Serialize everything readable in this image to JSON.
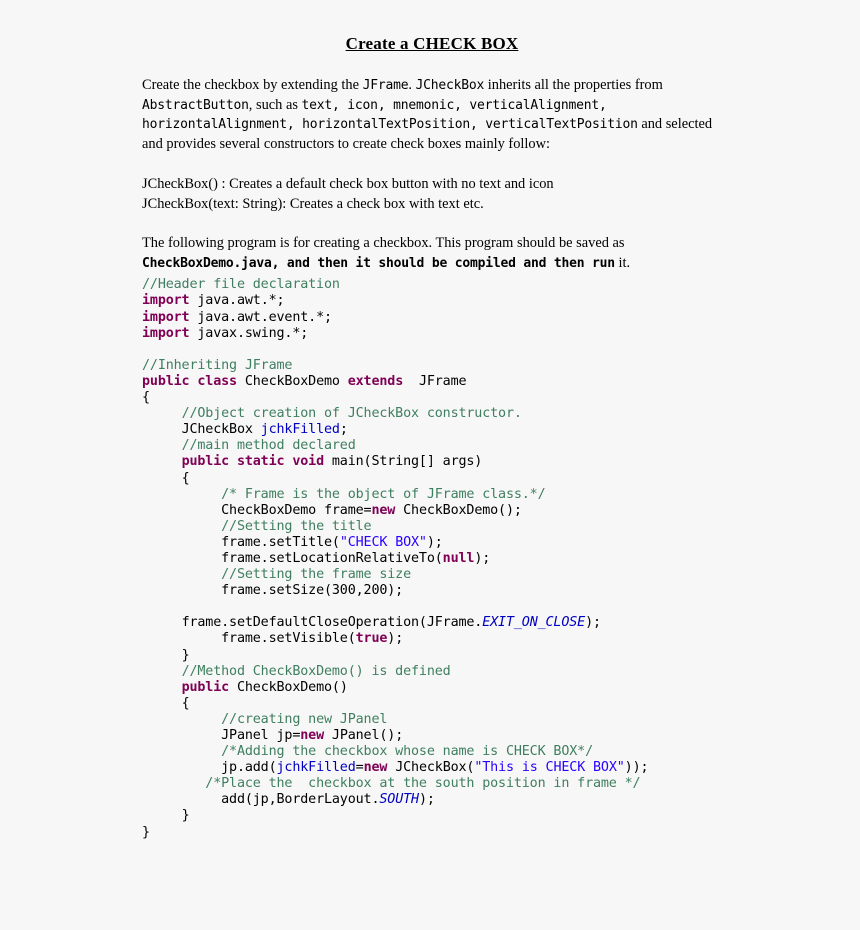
{
  "document": {
    "title": "Create a CHECK BOX",
    "background_color": "#f7f7f7",
    "text_color": "#000000"
  },
  "colors": {
    "comment": "#3f7f5f",
    "keyword": "#7f0055",
    "string": "#2a00ff",
    "field": "#0000c0"
  },
  "intro": {
    "p1_a": "Create the checkbox by extending the ",
    "p1_m1": "JFrame",
    "p1_b": ". ",
    "p1_m2": "JCheckBox",
    "p1_c": " inherits all the properties from ",
    "p1_m3": "AbstractButton",
    "p1_d": ", such as ",
    "p1_m4": "text, icon, mnemonic, verticalAlignment, horizontalAlignment, horizontalTextPosition, verticalTextPosition",
    "p1_e": " and selected and provides several constructors to create check boxes mainly follow:"
  },
  "signatures": [
    {
      "mono": "JCheckBox()",
      "serif": " : Creates a default check box button with no text and icon"
    },
    {
      "mono": "JCheckBox(text: String)",
      "serif": ": Creates a check box with text etc."
    }
  ],
  "save_note": {
    "serif_a": "The following program is for creating a checkbox. This program should be saved as ",
    "mono_bold": "CheckBoxDemo.java, and then it should be compiled and then run",
    "serif_b": " it."
  },
  "code": {
    "language": "java",
    "lines": [
      [
        {
          "t": "//Header file declaration",
          "c": "cmt"
        }
      ],
      [
        {
          "t": "import",
          "c": "kw"
        },
        {
          "t": " java.awt.*;",
          "c": "plain"
        }
      ],
      [
        {
          "t": "import",
          "c": "kw"
        },
        {
          "t": " java.awt.event.*;",
          "c": "plain"
        }
      ],
      [
        {
          "t": "import",
          "c": "kw"
        },
        {
          "t": " javax.swing.*;",
          "c": "plain"
        }
      ],
      [
        {
          "t": "",
          "c": "plain"
        }
      ],
      [
        {
          "t": "//Inheriting JFrame",
          "c": "cmt"
        }
      ],
      [
        {
          "t": "public class",
          "c": "kw"
        },
        {
          "t": " CheckBoxDemo ",
          "c": "plain"
        },
        {
          "t": "extends",
          "c": "kw"
        },
        {
          "t": "  JFrame",
          "c": "plain"
        }
      ],
      [
        {
          "t": "{",
          "c": "plain"
        }
      ],
      [
        {
          "t": "     //Object creation of JCheckBox constructor.",
          "c": "cmt"
        }
      ],
      [
        {
          "t": "     JCheckBox ",
          "c": "plain"
        },
        {
          "t": "jchkFilled",
          "c": "fld"
        },
        {
          "t": ";",
          "c": "plain"
        }
      ],
      [
        {
          "t": "     //main method declared",
          "c": "cmt"
        }
      ],
      [
        {
          "t": "     ",
          "c": "plain"
        },
        {
          "t": "public static void",
          "c": "kw"
        },
        {
          "t": " main(String[] args)",
          "c": "plain"
        }
      ],
      [
        {
          "t": "     {",
          "c": "plain"
        }
      ],
      [
        {
          "t": "          /* Frame is the object of JFrame class.*/",
          "c": "cmt"
        }
      ],
      [
        {
          "t": "          CheckBoxDemo frame=",
          "c": "plain"
        },
        {
          "t": "new",
          "c": "kw"
        },
        {
          "t": " CheckBoxDemo();",
          "c": "plain"
        }
      ],
      [
        {
          "t": "          //Setting the title",
          "c": "cmt"
        }
      ],
      [
        {
          "t": "          frame.setTitle(",
          "c": "plain"
        },
        {
          "t": "\"CHECK BOX\"",
          "c": "str"
        },
        {
          "t": ");",
          "c": "plain"
        }
      ],
      [
        {
          "t": "          frame.setLocationRelativeTo(",
          "c": "plain"
        },
        {
          "t": "null",
          "c": "kw"
        },
        {
          "t": ");",
          "c": "plain"
        }
      ],
      [
        {
          "t": "          //Setting the frame size",
          "c": "cmt"
        }
      ],
      [
        {
          "t": "          frame.setSize(300,200);",
          "c": "plain"
        }
      ],
      [
        {
          "t": "",
          "c": "plain"
        }
      ],
      [
        {
          "t": "     frame.setDefaultCloseOperation(JFrame.",
          "c": "plain"
        },
        {
          "t": "EXIT_ON_CLOSE",
          "c": "sfld"
        },
        {
          "t": ");",
          "c": "plain"
        }
      ],
      [
        {
          "t": "          frame.setVisible(",
          "c": "plain"
        },
        {
          "t": "true",
          "c": "kw"
        },
        {
          "t": ");",
          "c": "plain"
        }
      ],
      [
        {
          "t": "     }",
          "c": "plain"
        }
      ],
      [
        {
          "t": "     //Method CheckBoxDemo() is defined",
          "c": "cmt"
        }
      ],
      [
        {
          "t": "     ",
          "c": "plain"
        },
        {
          "t": "public",
          "c": "kw"
        },
        {
          "t": " CheckBoxDemo()",
          "c": "plain"
        }
      ],
      [
        {
          "t": "     {",
          "c": "plain"
        }
      ],
      [
        {
          "t": "          //creating new JPanel",
          "c": "cmt"
        }
      ],
      [
        {
          "t": "          JPanel jp=",
          "c": "plain"
        },
        {
          "t": "new",
          "c": "kw"
        },
        {
          "t": " JPanel();",
          "c": "plain"
        }
      ],
      [
        {
          "t": "          /*Adding the checkbox whose name is CHECK BOX*/",
          "c": "cmt"
        }
      ],
      [
        {
          "t": "          jp.add(",
          "c": "plain"
        },
        {
          "t": "jchkFilled",
          "c": "fld"
        },
        {
          "t": "=",
          "c": "plain"
        },
        {
          "t": "new",
          "c": "kw"
        },
        {
          "t": " JCheckBox(",
          "c": "plain"
        },
        {
          "t": "\"This is CHECK BOX\"",
          "c": "str"
        },
        {
          "t": "));",
          "c": "plain"
        }
      ],
      [
        {
          "t": "        /*Place the  checkbox at the south position in frame */",
          "c": "cmt"
        }
      ],
      [
        {
          "t": "          add(jp,BorderLayout.",
          "c": "plain"
        },
        {
          "t": "SOUTH",
          "c": "sfld"
        },
        {
          "t": ");",
          "c": "plain"
        }
      ],
      [
        {
          "t": "     }",
          "c": "plain"
        }
      ],
      [
        {
          "t": "}",
          "c": "plain"
        }
      ]
    ]
  }
}
